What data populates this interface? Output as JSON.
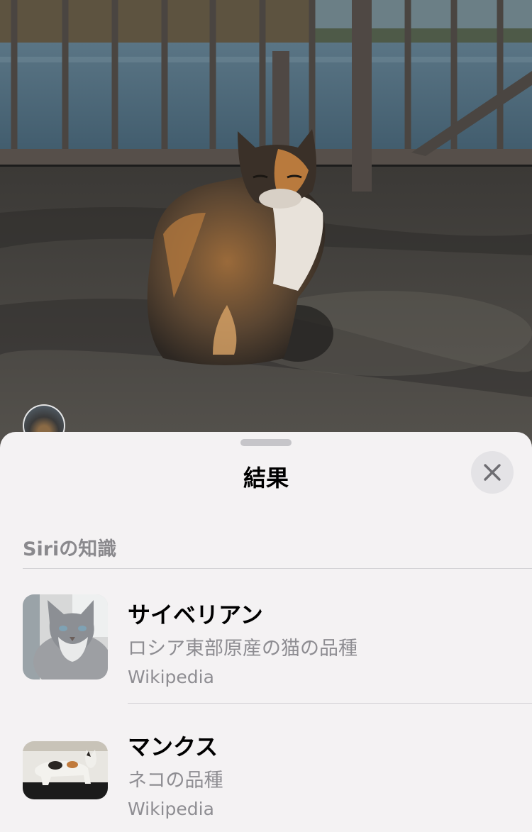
{
  "photo": {
    "subject_icon": "calico-cat-photo"
  },
  "sheet": {
    "title": "結果",
    "close_icon": "close-icon"
  },
  "section": {
    "header": "Siriの知識"
  },
  "results": [
    {
      "title": "サイベリアン",
      "description": "ロシア東部原産の猫の品種",
      "source": "Wikipedia",
      "thumbnail_icon": "siberian-cat-thumbnail"
    },
    {
      "title": "マンクス",
      "description": "ネコの品種",
      "source": "Wikipedia",
      "thumbnail_icon": "manx-cat-thumbnail"
    }
  ],
  "colors": {
    "sheet_background": "#f4f2f3",
    "secondary_text": "#8e8d92"
  }
}
